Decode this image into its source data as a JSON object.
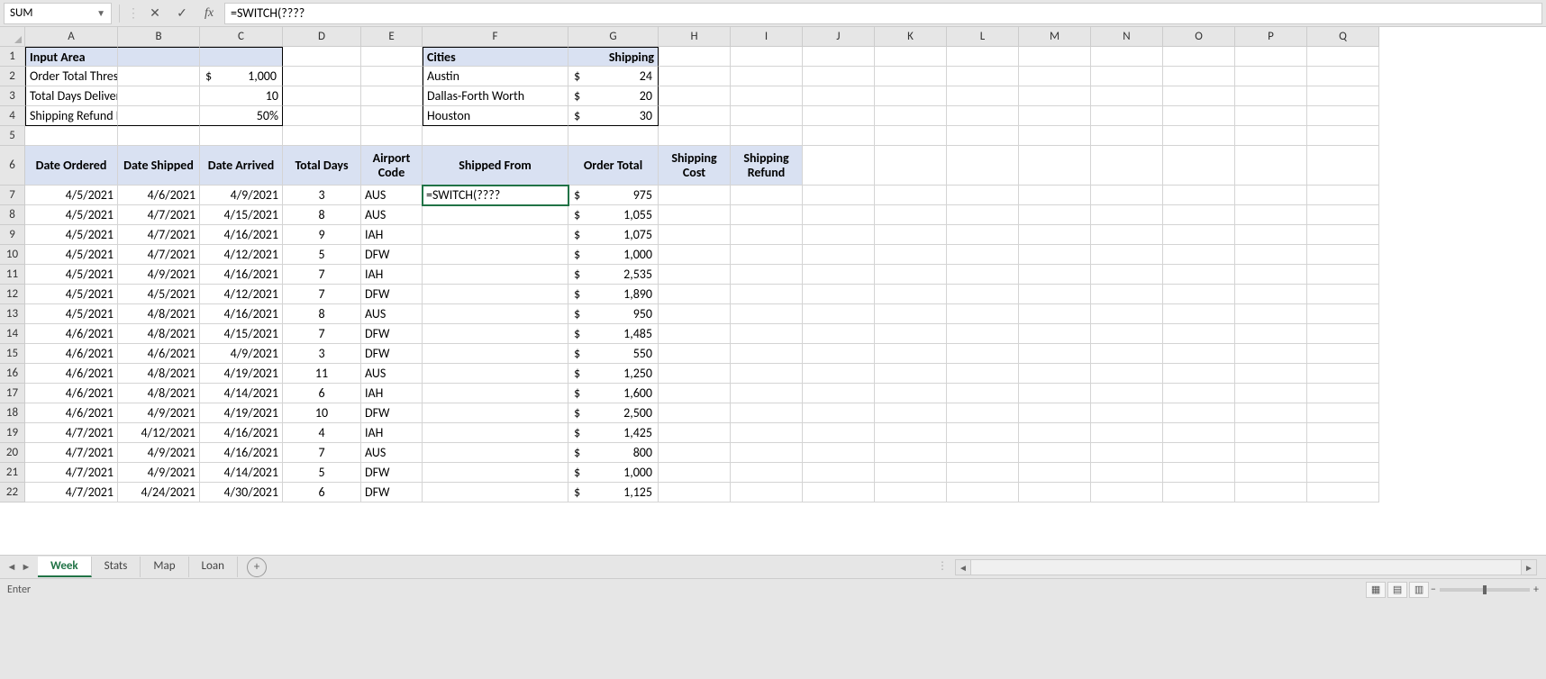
{
  "nameBox": "SUM",
  "formula": "=SWITCH(????",
  "statusText": "Enter",
  "columns": [
    "A",
    "B",
    "C",
    "D",
    "E",
    "F",
    "G",
    "H",
    "I",
    "J",
    "K",
    "L",
    "M",
    "N",
    "O",
    "P",
    "Q"
  ],
  "rowNumbers": [
    1,
    2,
    3,
    4,
    5,
    6,
    7,
    8,
    9,
    10,
    11,
    12,
    13,
    14,
    15,
    16,
    17,
    18,
    19,
    20,
    21,
    22
  ],
  "inputArea": {
    "title": "Input Area",
    "rows": [
      {
        "label": "Order Total Threshold",
        "sym": "$",
        "val": "1,000"
      },
      {
        "label": "Total Days Delivery Goal",
        "sym": "",
        "val": "10"
      },
      {
        "label": "Shipping Refund Rate",
        "sym": "",
        "val": "50%"
      }
    ]
  },
  "citiesBox": {
    "h1": "Cities",
    "h2": "Shipping",
    "rows": [
      {
        "city": "Austin",
        "sym": "$",
        "val": "24"
      },
      {
        "city": "Dallas-Forth Worth",
        "sym": "$",
        "val": "20"
      },
      {
        "city": "Houston",
        "sym": "$",
        "val": "30"
      }
    ]
  },
  "tableHeaders": [
    "Date Ordered",
    "Date Shipped",
    "Date Arrived",
    "Total Days",
    "Airport Code",
    "Shipped From",
    "Order Total",
    "Shipping Cost",
    "Shipping Refund"
  ],
  "editingCellValue": "=SWITCH(????",
  "dataRows": [
    {
      "a": "4/5/2021",
      "b": "4/6/2021",
      "c": "4/9/2021",
      "d": "3",
      "e": "AUS",
      "g": "975"
    },
    {
      "a": "4/5/2021",
      "b": "4/7/2021",
      "c": "4/15/2021",
      "d": "8",
      "e": "AUS",
      "g": "1,055"
    },
    {
      "a": "4/5/2021",
      "b": "4/7/2021",
      "c": "4/16/2021",
      "d": "9",
      "e": "IAH",
      "g": "1,075"
    },
    {
      "a": "4/5/2021",
      "b": "4/7/2021",
      "c": "4/12/2021",
      "d": "5",
      "e": "DFW",
      "g": "1,000"
    },
    {
      "a": "4/5/2021",
      "b": "4/9/2021",
      "c": "4/16/2021",
      "d": "7",
      "e": "IAH",
      "g": "2,535"
    },
    {
      "a": "4/5/2021",
      "b": "4/5/2021",
      "c": "4/12/2021",
      "d": "7",
      "e": "DFW",
      "g": "1,890"
    },
    {
      "a": "4/5/2021",
      "b": "4/8/2021",
      "c": "4/16/2021",
      "d": "8",
      "e": "AUS",
      "g": "950"
    },
    {
      "a": "4/6/2021",
      "b": "4/8/2021",
      "c": "4/15/2021",
      "d": "7",
      "e": "DFW",
      "g": "1,485"
    },
    {
      "a": "4/6/2021",
      "b": "4/6/2021",
      "c": "4/9/2021",
      "d": "3",
      "e": "DFW",
      "g": "550"
    },
    {
      "a": "4/6/2021",
      "b": "4/8/2021",
      "c": "4/19/2021",
      "d": "11",
      "e": "AUS",
      "g": "1,250"
    },
    {
      "a": "4/6/2021",
      "b": "4/8/2021",
      "c": "4/14/2021",
      "d": "6",
      "e": "IAH",
      "g": "1,600"
    },
    {
      "a": "4/6/2021",
      "b": "4/9/2021",
      "c": "4/19/2021",
      "d": "10",
      "e": "DFW",
      "g": "2,500"
    },
    {
      "a": "4/7/2021",
      "b": "4/12/2021",
      "c": "4/16/2021",
      "d": "4",
      "e": "IAH",
      "g": "1,425"
    },
    {
      "a": "4/7/2021",
      "b": "4/9/2021",
      "c": "4/16/2021",
      "d": "7",
      "e": "AUS",
      "g": "800"
    },
    {
      "a": "4/7/2021",
      "b": "4/9/2021",
      "c": "4/14/2021",
      "d": "5",
      "e": "DFW",
      "g": "1,000"
    },
    {
      "a": "4/7/2021",
      "b": "4/24/2021",
      "c": "4/30/2021",
      "d": "6",
      "e": "DFW",
      "g": "1,125"
    }
  ],
  "tabs": [
    "Week",
    "Stats",
    "Map",
    "Loan"
  ],
  "activeTab": "Week"
}
